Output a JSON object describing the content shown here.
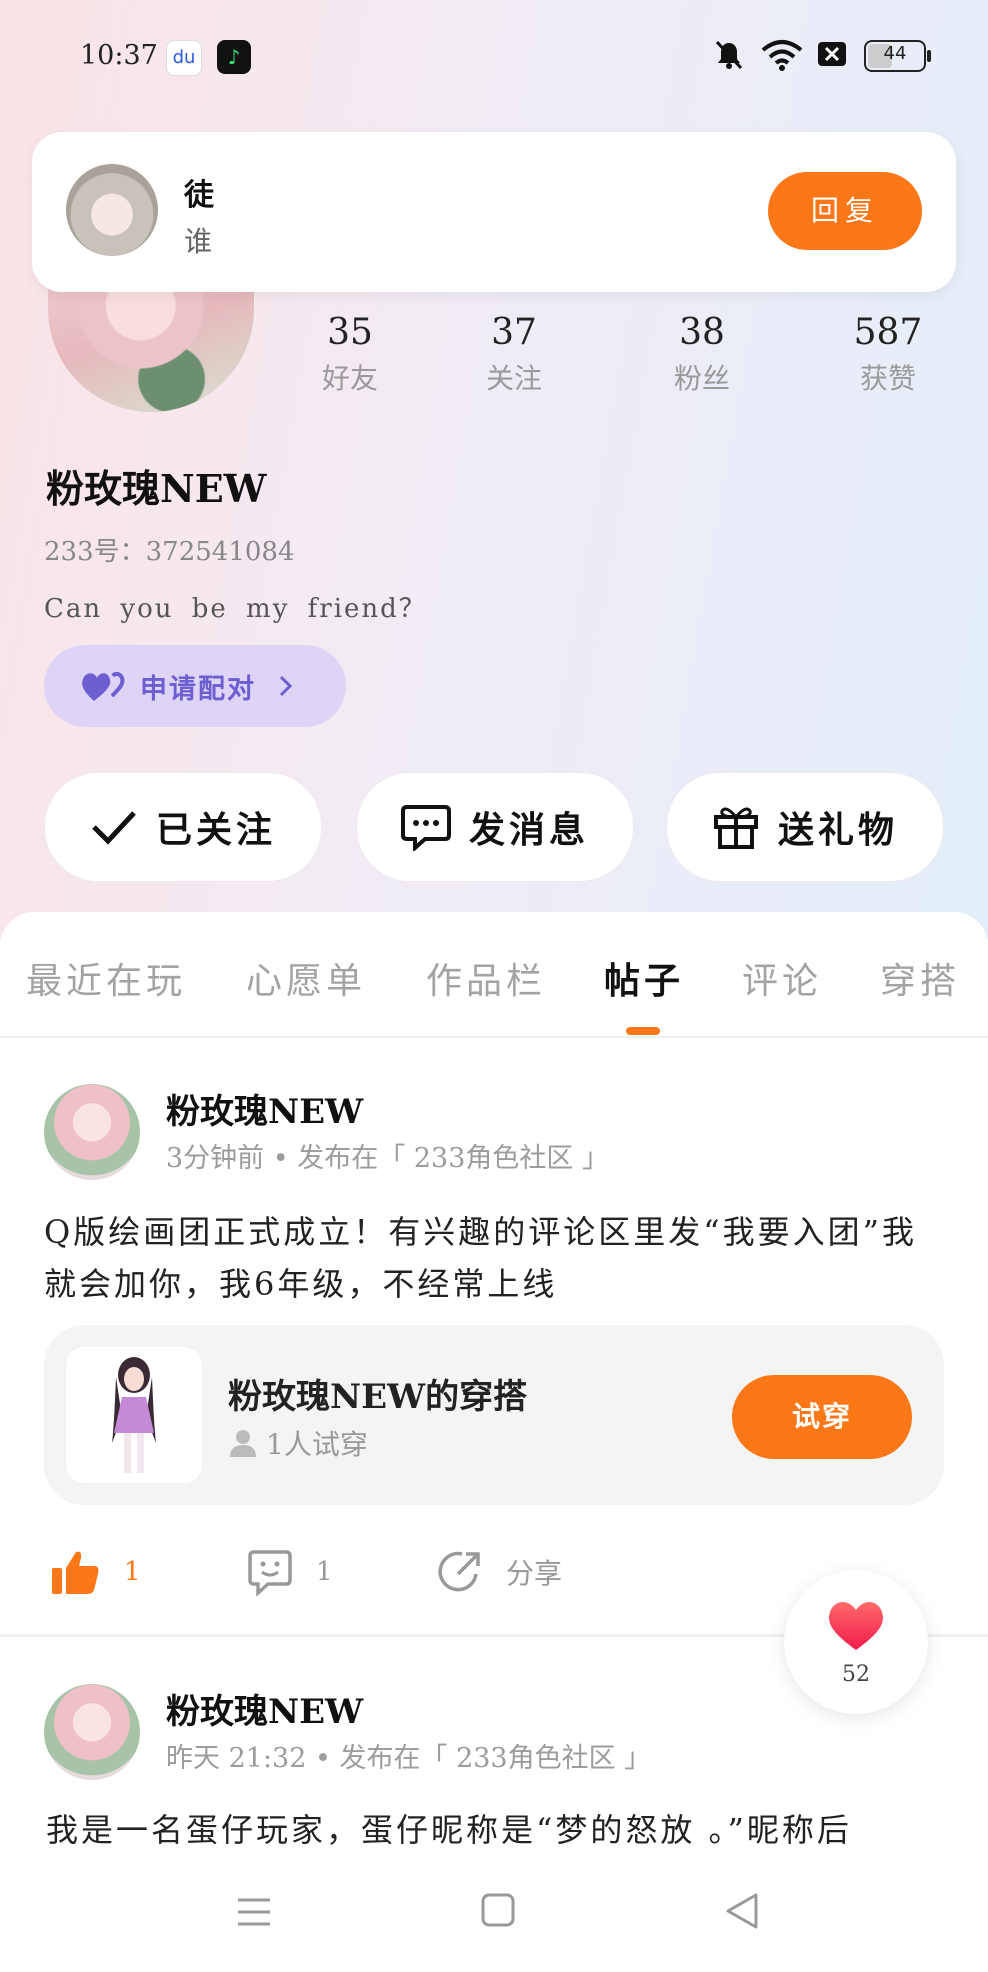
{
  "status_bar": {
    "time": "10:37",
    "battery": "44"
  },
  "notification": {
    "sender": "徒",
    "message": "谁",
    "reply_label": "回复"
  },
  "profile": {
    "stats": [
      {
        "value": "35",
        "label": "好友"
      },
      {
        "value": "37",
        "label": "关注"
      },
      {
        "value": "38",
        "label": "粉丝"
      },
      {
        "value": "587",
        "label": "获赞"
      }
    ],
    "name": "粉玫瑰NEW",
    "uid": "233号：372541084",
    "signature": "Can you be my friend？",
    "pair_label": "申请配对"
  },
  "actions": {
    "follow_label": "已关注",
    "message_label": "发消息",
    "gift_label": "送礼物"
  },
  "tabs": [
    {
      "label": "最近在玩"
    },
    {
      "label": "心愿单"
    },
    {
      "label": "作品栏"
    },
    {
      "label": "帖子"
    },
    {
      "label": "评论"
    },
    {
      "label": "穿搭"
    }
  ],
  "posts": [
    {
      "author": "粉玫瑰NEW",
      "meta": "3分钟前 • 发布在「 233角色社区 」",
      "text": "Q版绘画团正式成立！有兴趣的评论区里发“我要入团”我就会加你，我6年级，不经常上线",
      "outfit": {
        "title": "粉玫瑰NEW的穿搭",
        "tried": "1人试穿",
        "try_label": "试穿"
      },
      "likes": "1",
      "comments": "1",
      "share_label": "分享"
    },
    {
      "author": "粉玫瑰NEW",
      "meta": "昨天 21:32 • 发布在「 233角色社区 」",
      "text": "我是一名蛋仔玩家，蛋仔昵称是“梦的怒放 。”昵称后"
    }
  ],
  "floating_like": {
    "count": "52"
  },
  "colors": {
    "accent": "#fb7718",
    "pair_bg": "#ded4f5",
    "pair_text": "#6d5fd0"
  }
}
